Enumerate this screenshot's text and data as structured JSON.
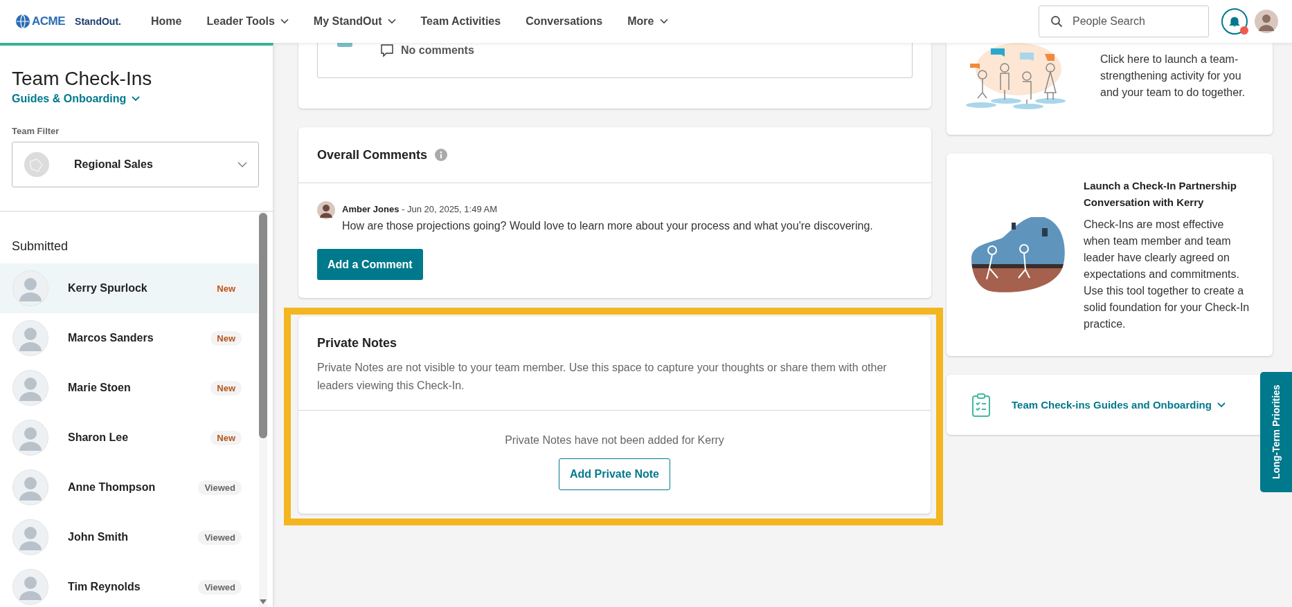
{
  "header": {
    "logo": {
      "brand": "ACME",
      "product": "StandOut."
    },
    "nav": [
      {
        "label": "Home",
        "dropdown": false
      },
      {
        "label": "Leader Tools",
        "dropdown": true
      },
      {
        "label": "My StandOut",
        "dropdown": true
      },
      {
        "label": "Team Activities",
        "dropdown": false
      },
      {
        "label": "Conversations",
        "dropdown": false
      },
      {
        "label": "More",
        "dropdown": true
      }
    ],
    "search": {
      "placeholder": "People Search"
    },
    "notifications": {
      "unread": true
    }
  },
  "sidebar": {
    "title": "Team Check-Ins",
    "guides_link": "Guides & Onboarding",
    "team_filter": {
      "label": "Team Filter",
      "value": "Regional Sales"
    },
    "section": "Submitted",
    "members": [
      {
        "name": "Kerry Spurlock",
        "status": "New",
        "kind": "new",
        "selected": true
      },
      {
        "name": "Marcos Sanders",
        "status": "New",
        "kind": "new",
        "selected": false
      },
      {
        "name": "Marie Stoen",
        "status": "New",
        "kind": "new",
        "selected": false
      },
      {
        "name": "Sharon Lee",
        "status": "New",
        "kind": "new",
        "selected": false
      },
      {
        "name": "Anne Thompson",
        "status": "Viewed",
        "kind": "viewed",
        "selected": false
      },
      {
        "name": "John Smith",
        "status": "Viewed",
        "kind": "viewed",
        "selected": false
      },
      {
        "name": "Tim Reynolds",
        "status": "Viewed",
        "kind": "viewed",
        "selected": false
      }
    ]
  },
  "top_card": {
    "comments": "No comments"
  },
  "overall_comments": {
    "title": "Overall Comments",
    "comment": {
      "author": "Amber Jones",
      "meta": " - Jun 20, 2025, 1:49 AM",
      "text": "How are those projections going? Would love to learn more about your process and what you're discovering."
    },
    "button": "Add a Comment"
  },
  "private_notes": {
    "highlighted": true,
    "title": "Private Notes",
    "description": "Private Notes are not visible to your team member. Use this space to capture your thoughts or share them with other leaders viewing this Check-In.",
    "empty_text": "Private Notes have not been added for Kerry",
    "button": "Add Private Note"
  },
  "activity_card": {
    "text": "Click here to launch a team-strengthening activity for you and your team to do together."
  },
  "partnership_card": {
    "title": "Launch a Check-In Partnership Conversation with Kerry",
    "text": "Check-Ins are most effective when team member and team leader have clearly agreed on expectations and commitments. Use this tool together to create a solid foundation for your Check-In practice."
  },
  "guides_card": {
    "label": "Team Check-ins Guides and Onboarding"
  },
  "side_tab": {
    "label": "Long-Term Priorities"
  }
}
